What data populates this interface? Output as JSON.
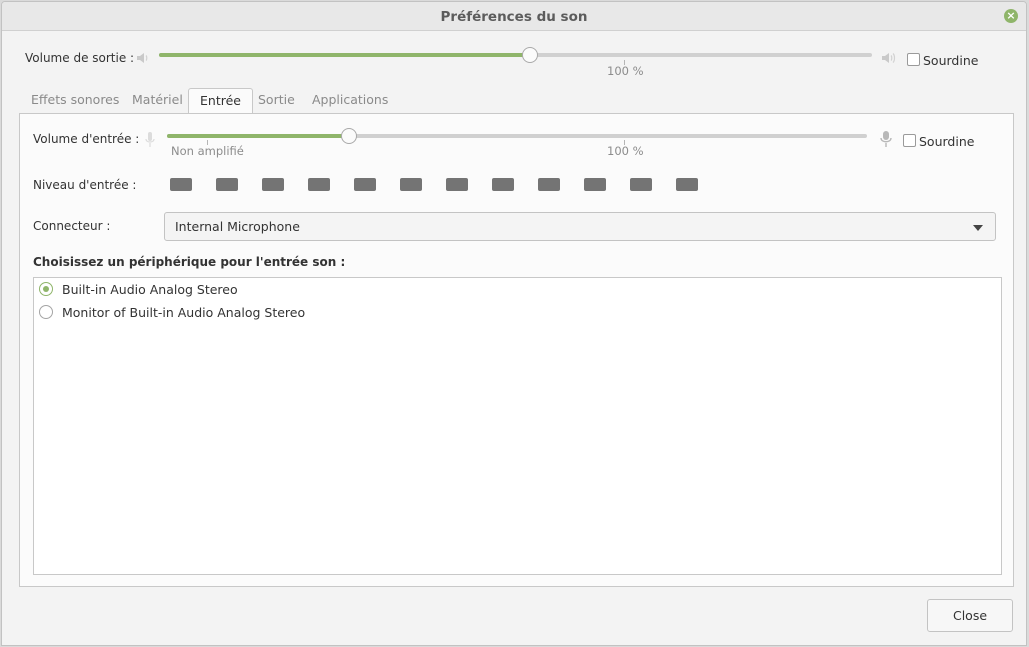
{
  "window": {
    "title": "Préférences du son"
  },
  "output": {
    "label": "Volume de sortie :",
    "volume_percent": 52,
    "tick_label": "100 %",
    "mute_label": "Sourdine",
    "muted": false
  },
  "tabs": [
    {
      "label": "Effets sonores",
      "active": false
    },
    {
      "label": "Matériel",
      "active": false
    },
    {
      "label": "Entrée",
      "active": true
    },
    {
      "label": "Sortie",
      "active": false
    },
    {
      "label": "Applications",
      "active": false
    }
  ],
  "input": {
    "volume_label": "Volume d'entrée :",
    "volume_percent": 26,
    "tick_unamplified": "Non amplifié",
    "tick_100": "100 %",
    "mute_label": "Sourdine",
    "muted": false,
    "level_label": "Niveau d'entrée :",
    "level_segments": 12,
    "connector_label": "Connecteur :",
    "connector_value": "Internal Microphone",
    "device_heading": "Choisissez un périphérique pour l'entrée son :",
    "devices": [
      {
        "label": "Built-in Audio Analog Stereo",
        "selected": true
      },
      {
        "label": "Monitor of Built-in Audio Analog Stereo",
        "selected": false
      }
    ]
  },
  "footer": {
    "close_label": "Close"
  },
  "colors": {
    "accent": "#8fb56a",
    "level": "#747474"
  }
}
